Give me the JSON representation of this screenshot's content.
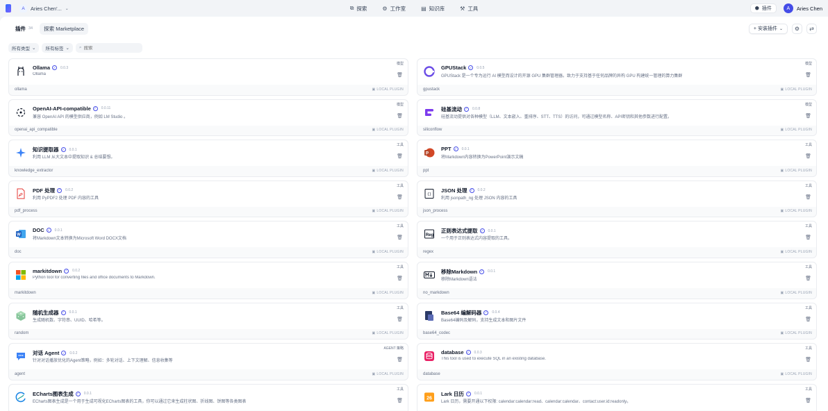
{
  "topbar": {
    "workspace_initial": "A",
    "workspace_name": "Aries Chen'...",
    "nav": [
      {
        "icon": "explore-icon",
        "glyph": "⧉",
        "label": "探索"
      },
      {
        "icon": "studio-icon",
        "glyph": "⚙",
        "label": "工作室"
      },
      {
        "icon": "knowledge-icon",
        "glyph": "▤",
        "label": "知识库"
      },
      {
        "icon": "tools-icon",
        "glyph": "⚒",
        "label": "工具"
      }
    ],
    "plugins_label": "插件",
    "user_initial": "A",
    "user_name": "Aries Chen"
  },
  "tabs": {
    "plugins_label": "插件",
    "plugins_count": "34",
    "marketplace_label": "探索 Marketplace",
    "install_label": "+ 安装插件"
  },
  "filters": {
    "category_label": "所有类型",
    "tags_label": "所有标签",
    "search_placeholder": "搜索"
  },
  "local_plugin_label": "LOCAL PLUGIN",
  "colors": {
    "accent": "#444ce7",
    "background": "#f2f4f7"
  },
  "plugins": [
    {
      "name": "Ollama",
      "version": "0.0.3",
      "desc": "Ollama",
      "id": "ollama",
      "tag": "模型",
      "icon": "ollama-icon"
    },
    {
      "name": "GPUStack",
      "version": "0.0.5",
      "desc": "GPUStack 是一个专为运行 AI 模型而设计的开源 GPU 集群管理器。致力于支持基于任何品牌的异构 GPU 构建统一管理的算力集群",
      "id": "gpustack",
      "tag": "模型",
      "icon": "gpustack-icon"
    },
    {
      "name": "OpenAI-API-compatible",
      "version": "0.0.11",
      "desc": "兼容 OpenAI API 的模型供应商，例如 LM Studio 。",
      "id": "openai_api_compatible",
      "tag": "模型",
      "icon": "openai-compatible-icon"
    },
    {
      "name": "硅基流动",
      "version": "0.0.8",
      "desc": "硅基流动提供对各种模型（LLM、文本嵌入、重排序、STT、TTS）的访问，可通过模型名称、API密钥和其他参数进行配置。",
      "id": "siliconflow",
      "tag": "模型",
      "icon": "siliconflow-icon"
    },
    {
      "name": "知识提取器",
      "version": "0.0.1",
      "desc": "利用 LLM 从大文本中提取知识 & 总结要想。",
      "id": "knowledge_extractor",
      "tag": "工具",
      "icon": "sparkle-icon"
    },
    {
      "name": "PPT",
      "version": "0.0.1",
      "desc": "将Markdown内容转换为PowerPoint演示文稿",
      "id": "ppt",
      "tag": "工具",
      "icon": "powerpoint-icon"
    },
    {
      "name": "PDF 处理",
      "version": "0.0.2",
      "desc": "利用 PyPDF2 处理 PDF 内容的工具",
      "id": "pdf_process",
      "tag": "工具",
      "icon": "pdf-icon"
    },
    {
      "name": "JSON 处理",
      "version": "0.0.2",
      "desc": "利用 jsonpath_ng 处理 JSON 内容的工具",
      "id": "json_process",
      "tag": "工具",
      "icon": "json-icon"
    },
    {
      "name": "DOC",
      "version": "0.0.1",
      "desc": "将Markdown文本转换为Microsoft Word DOCX文档",
      "id": "doc",
      "tag": "工具",
      "icon": "word-icon"
    },
    {
      "name": "正则表达式提取",
      "version": "0.0.1",
      "desc": "一个用于正则表达式内容提取的工具。",
      "id": "regex",
      "tag": "工具",
      "icon": "regex-icon"
    },
    {
      "name": "markitdown",
      "version": "0.0.2",
      "desc": "Python tool for converting files and office documents to Markdown.",
      "id": "markitdown",
      "tag": "工具",
      "icon": "windows-logo-icon"
    },
    {
      "name": "移除Markdown",
      "version": "0.0.1",
      "desc": "移除Markdown语法",
      "id": "no_markdown",
      "tag": "工具",
      "icon": "markdown-icon"
    },
    {
      "name": "随机生成器",
      "version": "0.0.1",
      "desc": "生成随机数、字符串、UUID、哈希等。",
      "id": "random",
      "tag": "工具",
      "icon": "dice-icon"
    },
    {
      "name": "Base64 编解码器",
      "version": "0.0.4",
      "desc": "Base64编码及解码，支持生成文本和图片文件",
      "id": "base64_codec",
      "tag": "工具",
      "icon": "base64-icon"
    },
    {
      "name": "对话 Agent",
      "version": "0.0.2",
      "desc": "针对对话播放优化的Agent策略，例如：多轮对话、上下文理解、信息收集等",
      "id": "agent",
      "tag": "AGENT 策略",
      "icon": "chat-agent-icon"
    },
    {
      "name": "database",
      "version": "0.0.3",
      "desc": "This tool is used to execute SQL in an existing database.",
      "id": "database",
      "tag": "工具",
      "icon": "database-icon"
    },
    {
      "name": "ECharts图表生成",
      "version": "0.0.1",
      "desc": "ECharts图表生成是一个用于生成可视化ECharts图表的工具，你可以通过它来生成柱状图、折线图、饼图等各类图表",
      "id": "echarts",
      "tag": "工具",
      "icon": "echarts-icon"
    },
    {
      "name": "Lark 日历",
      "version": "0.0.1",
      "desc": "Lark 日历，需要开通以下权限: calendar:calendar:read、calendar:calendar、contact:user.id:readonly。",
      "id": "lark_calendar",
      "tag": "工具",
      "icon": "lark-calendar-icon"
    }
  ]
}
